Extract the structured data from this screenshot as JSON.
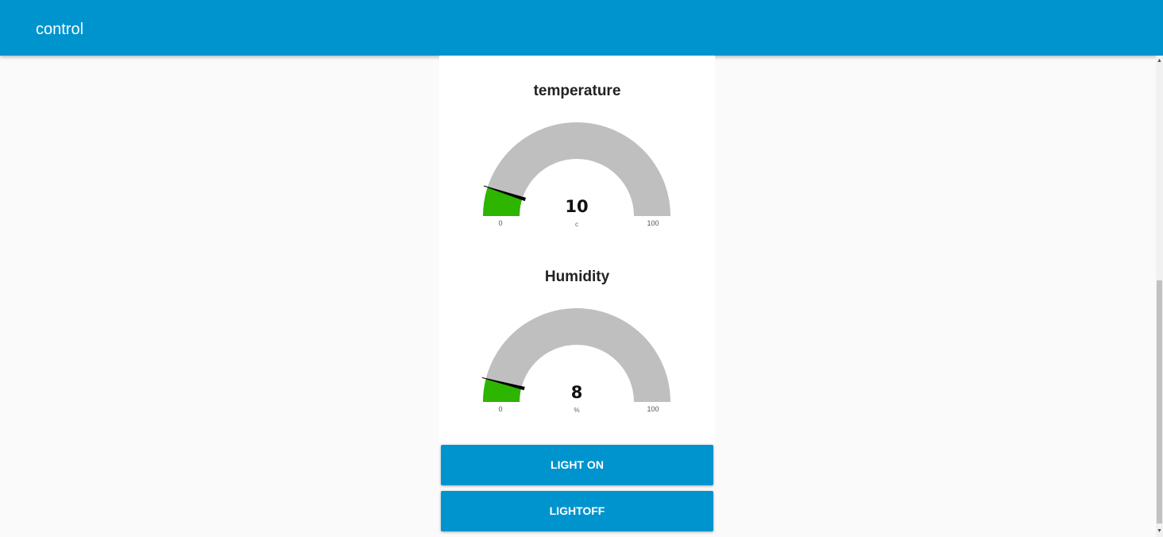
{
  "app": {
    "title": "control"
  },
  "gauges": [
    {
      "title": "temperature",
      "value": 10,
      "value_text": "10",
      "units": "c",
      "min": 0,
      "max": 100,
      "min_label": "0",
      "max_label": "100"
    },
    {
      "title": "Humidity",
      "value": 8,
      "value_text": "8",
      "units": "%",
      "min": 0,
      "max": 100,
      "min_label": "0",
      "max_label": "100"
    }
  ],
  "buttons": {
    "light_on": "LIGHT ON",
    "light_off": "LIGHTOFF"
  },
  "colors": {
    "accent": "#0094ce",
    "gauge_fill": "#2db500",
    "gauge_track": "#bfbfbf",
    "needle": "#000000",
    "background": "#fafafa"
  },
  "icons": {
    "scroll_up": "triangle-up",
    "scroll_down": "triangle-down"
  }
}
